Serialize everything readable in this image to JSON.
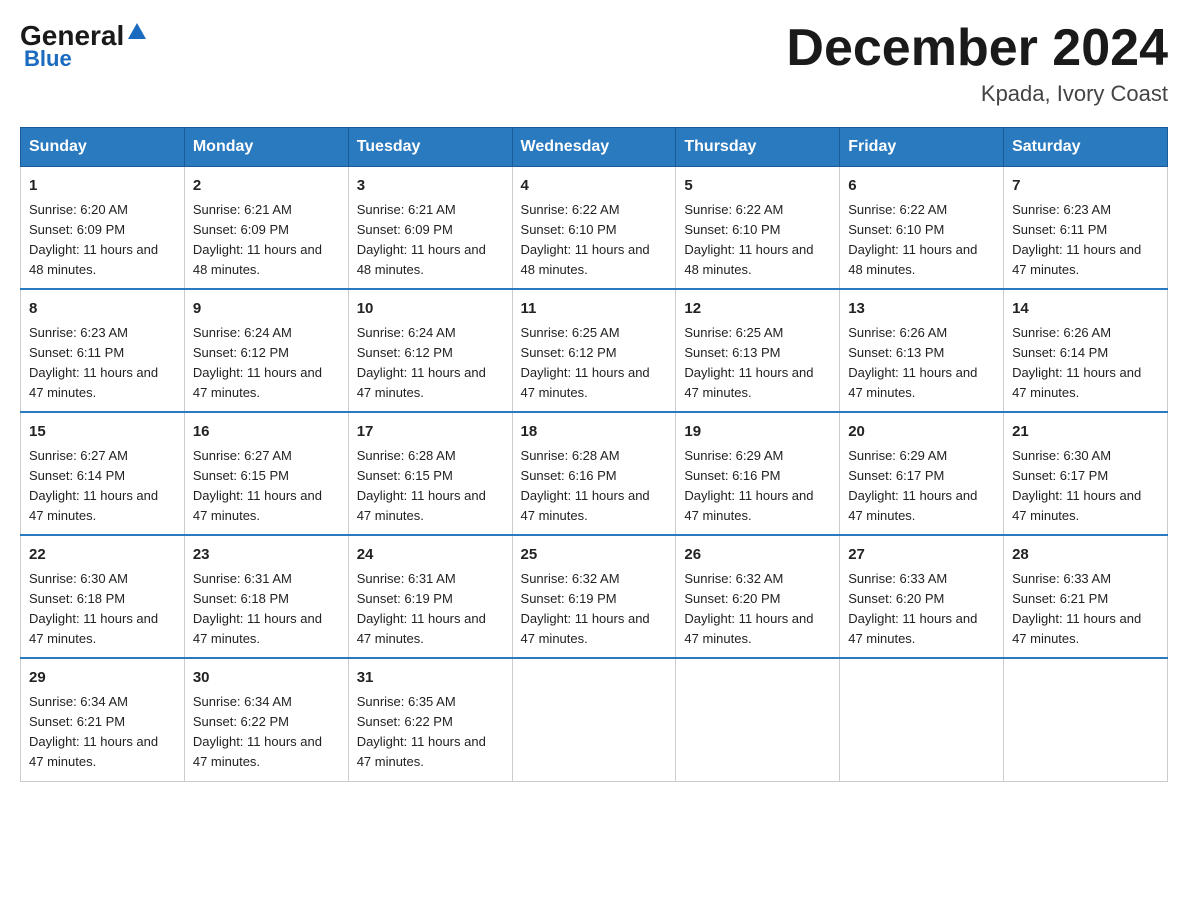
{
  "logo": {
    "general": "General",
    "blue": "Blue",
    "sub": "Blue"
  },
  "header": {
    "title": "December 2024",
    "location": "Kpada, Ivory Coast"
  },
  "days_of_week": [
    "Sunday",
    "Monday",
    "Tuesday",
    "Wednesday",
    "Thursday",
    "Friday",
    "Saturday"
  ],
  "weeks": [
    [
      {
        "day": "1",
        "sunrise": "6:20 AM",
        "sunset": "6:09 PM",
        "daylight": "11 hours and 48 minutes."
      },
      {
        "day": "2",
        "sunrise": "6:21 AM",
        "sunset": "6:09 PM",
        "daylight": "11 hours and 48 minutes."
      },
      {
        "day": "3",
        "sunrise": "6:21 AM",
        "sunset": "6:09 PM",
        "daylight": "11 hours and 48 minutes."
      },
      {
        "day": "4",
        "sunrise": "6:22 AM",
        "sunset": "6:10 PM",
        "daylight": "11 hours and 48 minutes."
      },
      {
        "day": "5",
        "sunrise": "6:22 AM",
        "sunset": "6:10 PM",
        "daylight": "11 hours and 48 minutes."
      },
      {
        "day": "6",
        "sunrise": "6:22 AM",
        "sunset": "6:10 PM",
        "daylight": "11 hours and 48 minutes."
      },
      {
        "day": "7",
        "sunrise": "6:23 AM",
        "sunset": "6:11 PM",
        "daylight": "11 hours and 47 minutes."
      }
    ],
    [
      {
        "day": "8",
        "sunrise": "6:23 AM",
        "sunset": "6:11 PM",
        "daylight": "11 hours and 47 minutes."
      },
      {
        "day": "9",
        "sunrise": "6:24 AM",
        "sunset": "6:12 PM",
        "daylight": "11 hours and 47 minutes."
      },
      {
        "day": "10",
        "sunrise": "6:24 AM",
        "sunset": "6:12 PM",
        "daylight": "11 hours and 47 minutes."
      },
      {
        "day": "11",
        "sunrise": "6:25 AM",
        "sunset": "6:12 PM",
        "daylight": "11 hours and 47 minutes."
      },
      {
        "day": "12",
        "sunrise": "6:25 AM",
        "sunset": "6:13 PM",
        "daylight": "11 hours and 47 minutes."
      },
      {
        "day": "13",
        "sunrise": "6:26 AM",
        "sunset": "6:13 PM",
        "daylight": "11 hours and 47 minutes."
      },
      {
        "day": "14",
        "sunrise": "6:26 AM",
        "sunset": "6:14 PM",
        "daylight": "11 hours and 47 minutes."
      }
    ],
    [
      {
        "day": "15",
        "sunrise": "6:27 AM",
        "sunset": "6:14 PM",
        "daylight": "11 hours and 47 minutes."
      },
      {
        "day": "16",
        "sunrise": "6:27 AM",
        "sunset": "6:15 PM",
        "daylight": "11 hours and 47 minutes."
      },
      {
        "day": "17",
        "sunrise": "6:28 AM",
        "sunset": "6:15 PM",
        "daylight": "11 hours and 47 minutes."
      },
      {
        "day": "18",
        "sunrise": "6:28 AM",
        "sunset": "6:16 PM",
        "daylight": "11 hours and 47 minutes."
      },
      {
        "day": "19",
        "sunrise": "6:29 AM",
        "sunset": "6:16 PM",
        "daylight": "11 hours and 47 minutes."
      },
      {
        "day": "20",
        "sunrise": "6:29 AM",
        "sunset": "6:17 PM",
        "daylight": "11 hours and 47 minutes."
      },
      {
        "day": "21",
        "sunrise": "6:30 AM",
        "sunset": "6:17 PM",
        "daylight": "11 hours and 47 minutes."
      }
    ],
    [
      {
        "day": "22",
        "sunrise": "6:30 AM",
        "sunset": "6:18 PM",
        "daylight": "11 hours and 47 minutes."
      },
      {
        "day": "23",
        "sunrise": "6:31 AM",
        "sunset": "6:18 PM",
        "daylight": "11 hours and 47 minutes."
      },
      {
        "day": "24",
        "sunrise": "6:31 AM",
        "sunset": "6:19 PM",
        "daylight": "11 hours and 47 minutes."
      },
      {
        "day": "25",
        "sunrise": "6:32 AM",
        "sunset": "6:19 PM",
        "daylight": "11 hours and 47 minutes."
      },
      {
        "day": "26",
        "sunrise": "6:32 AM",
        "sunset": "6:20 PM",
        "daylight": "11 hours and 47 minutes."
      },
      {
        "day": "27",
        "sunrise": "6:33 AM",
        "sunset": "6:20 PM",
        "daylight": "11 hours and 47 minutes."
      },
      {
        "day": "28",
        "sunrise": "6:33 AM",
        "sunset": "6:21 PM",
        "daylight": "11 hours and 47 minutes."
      }
    ],
    [
      {
        "day": "29",
        "sunrise": "6:34 AM",
        "sunset": "6:21 PM",
        "daylight": "11 hours and 47 minutes."
      },
      {
        "day": "30",
        "sunrise": "6:34 AM",
        "sunset": "6:22 PM",
        "daylight": "11 hours and 47 minutes."
      },
      {
        "day": "31",
        "sunrise": "6:35 AM",
        "sunset": "6:22 PM",
        "daylight": "11 hours and 47 minutes."
      },
      null,
      null,
      null,
      null
    ]
  ]
}
